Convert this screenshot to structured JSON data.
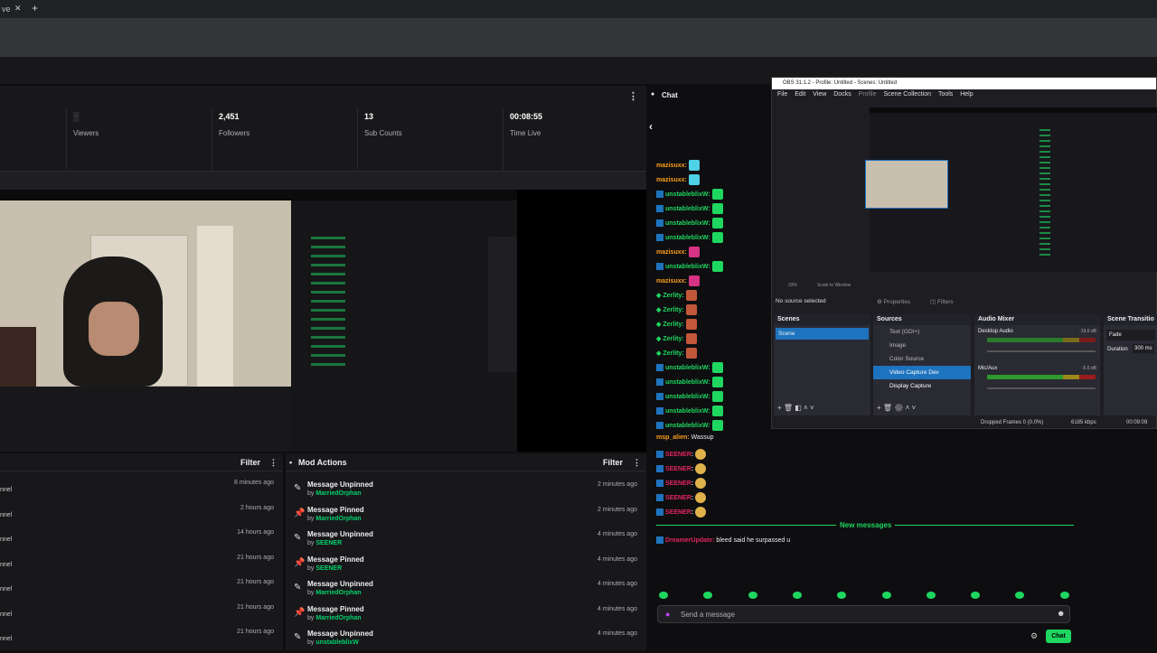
{
  "browser": {
    "tab_title": "ve",
    "close_glyph": "✕",
    "new_tab_glyph": "+"
  },
  "stats": {
    "viewers_value": "▒",
    "viewers_label": "Viewers",
    "followers_value": "2,451",
    "followers_label": "Followers",
    "subs_value": "13",
    "subs_label": "Sub Counts",
    "time_value": "00:08:55",
    "time_label": "Time Live",
    "menu": "⋮"
  },
  "activity": {
    "filter": "Filter",
    "menu": "⋮",
    "rows": [
      {
        "left": "nnel",
        "time": "8 minutes ago"
      },
      {
        "left": "nnel",
        "time": "2 hours ago"
      },
      {
        "left": "nnel",
        "time": "14 hours ago"
      },
      {
        "left": "nnel",
        "time": "21 hours ago"
      },
      {
        "left": "nnel",
        "time": "21 hours ago"
      },
      {
        "left": "nnel",
        "time": "21 hours ago"
      },
      {
        "left": "nnel",
        "time": "21 hours ago"
      }
    ]
  },
  "mod_actions": {
    "title": "Mod Actions",
    "filter": "Filter",
    "menu": "⋮",
    "rows": [
      {
        "action": "Message Unpinned",
        "by": "by",
        "user": "MarriedOrphan",
        "time": "2 minutes ago",
        "icon": "unpin-icon"
      },
      {
        "action": "Message Pinned",
        "by": "by",
        "user": "MarriedOrphan",
        "time": "2 minutes ago",
        "icon": "pin-icon"
      },
      {
        "action": "Message Unpinned",
        "by": "by",
        "user": "SEENER",
        "time": "4 minutes ago",
        "icon": "unpin-icon"
      },
      {
        "action": "Message Pinned",
        "by": "by",
        "user": "SEENER",
        "time": "4 minutes ago",
        "icon": "pin-icon"
      },
      {
        "action": "Message Unpinned",
        "by": "by",
        "user": "MarriedOrphan",
        "time": "4 minutes ago",
        "icon": "unpin-icon"
      },
      {
        "action": "Message Pinned",
        "by": "by",
        "user": "MarriedOrphan",
        "time": "4 minutes ago",
        "icon": "pin-icon"
      },
      {
        "action": "Message Unpinned",
        "by": "by",
        "user": "unstableblixW",
        "time": "4 minutes ago",
        "icon": "unpin-icon"
      }
    ]
  },
  "chat": {
    "title": "Chat",
    "back": "‹",
    "messages": [
      {
        "user": "mazisuxx:",
        "color": "#ff9f1c",
        "badge": false,
        "emote": "#4fd1e6"
      },
      {
        "user": "mazisuxx:",
        "color": "#ff9f1c",
        "badge": false,
        "emote": "#4fd1e6"
      },
      {
        "user": "unstableblixW:",
        "color": "#1ed760",
        "badge": true,
        "emote": "#1ed760"
      },
      {
        "user": "unstableblixW:",
        "color": "#1ed760",
        "badge": true,
        "emote": "#1ed760"
      },
      {
        "user": "unstableblixW:",
        "color": "#1ed760",
        "badge": true,
        "emote": "#1ed760"
      },
      {
        "user": "unstableblixW:",
        "color": "#1ed760",
        "badge": true,
        "emote": "#1ed760"
      },
      {
        "user": "mazisuxx:",
        "color": "#ff9f1c",
        "badge": false,
        "emote": "#d63384"
      },
      {
        "user": "unstableblixW:",
        "color": "#1ed760",
        "badge": true,
        "emote": "#1ed760"
      },
      {
        "user": "mazisuxx:",
        "color": "#ff9f1c",
        "badge": false,
        "emote": "#d63384"
      },
      {
        "user": "Zerlity:",
        "color": "#1ed760",
        "badge": false,
        "emote": "#c2573a"
      },
      {
        "user": "Zerlity:",
        "color": "#1ed760",
        "badge": false,
        "emote": "#c2573a"
      },
      {
        "user": "Zerlity:",
        "color": "#1ed760",
        "badge": false,
        "emote": "#c2573a"
      },
      {
        "user": "Zerlity:",
        "color": "#1ed760",
        "badge": false,
        "emote": "#c2573a"
      },
      {
        "user": "Zerlity:",
        "color": "#1ed760",
        "badge": false,
        "emote": "#c2573a"
      },
      {
        "user": "unstableblixW:",
        "color": "#1ed760",
        "badge": true,
        "emote": "#1ed760"
      },
      {
        "user": "unstableblixW:",
        "color": "#1ed760",
        "badge": true,
        "emote": "#1ed760"
      },
      {
        "user": "unstableblixW:",
        "color": "#1ed760",
        "badge": true,
        "emote": "#1ed760"
      },
      {
        "user": "unstableblixW:",
        "color": "#1ed760",
        "badge": true,
        "emote": "#1ed760"
      },
      {
        "user": "unstableblixW:",
        "color": "#1ed760",
        "badge": true,
        "emote": "#1ed760"
      }
    ],
    "msp_user": "msp_alien:",
    "msp_text": "Wassup",
    "seener_user": "SEENER",
    "new_messages": "New messages",
    "last_user": "DreamerUpdate:",
    "last_text": "bleed said he surpassed u",
    "input_placeholder": "Send a message",
    "chat_button": "Chat"
  },
  "obs": {
    "title": "OBS 31.1.2 - Profile: Untitled - Scenes: Untitled",
    "menu": [
      "File",
      "Edit",
      "View",
      "Docks",
      "Profile",
      "Scene Collection",
      "Tools",
      "Help"
    ],
    "zoom": "33%",
    "scale_mode": "Scale to Window",
    "no_source": "No source selected",
    "properties": "Properties",
    "filters": "Filters",
    "scenes_title": "Scenes",
    "scene_item": "Scene",
    "sources_title": "Sources",
    "sources": [
      "Text (GDI+)",
      "Image",
      "Color Source",
      "Video Capture Dev",
      "Display Capture"
    ],
    "mixer_title": "Audio Mixer",
    "desktop_audio": "Desktop Audio",
    "desktop_db": "-19.6 dB",
    "mic": "Mic/Aux",
    "mic_db": "-5.6 dB",
    "transitions_title": "Scene Transitio",
    "transition": "Fade",
    "duration_label": "Duration",
    "duration_value": "300 ms",
    "dropped": "Dropped Frames 0 (0.0%)",
    "bitrate": "6185 kbps",
    "time": "00:09:09"
  }
}
